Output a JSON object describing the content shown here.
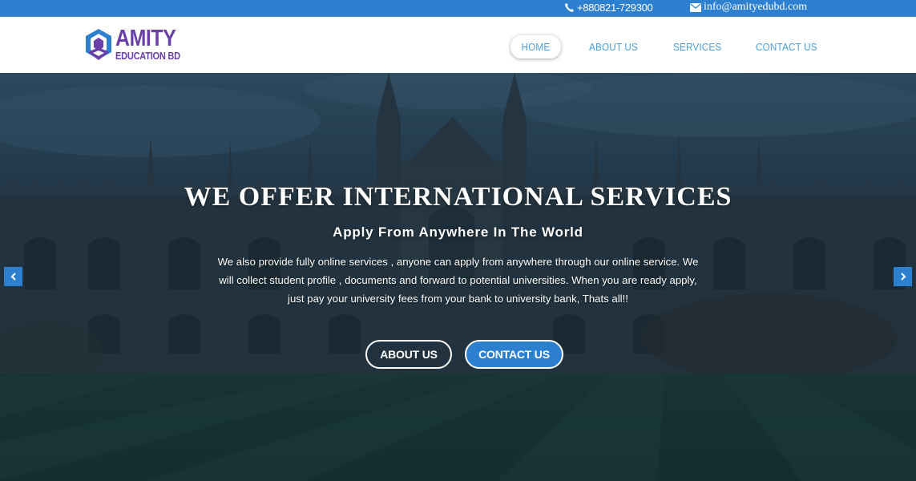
{
  "topbar": {
    "phone": "+880821-729300",
    "email": "info@amityedubd.com",
    "background": "#2d7fd0"
  },
  "brand": {
    "title": "AMITY",
    "subtitle": "EDUCATION BD",
    "color": "#6a3fa7"
  },
  "nav": {
    "items": [
      {
        "label": "HOME",
        "active": true
      },
      {
        "label": "ABOUT US",
        "active": false
      },
      {
        "label": "SERVICES",
        "active": false
      },
      {
        "label": "CONTACT US",
        "active": false
      }
    ],
    "color": "#4aa0e0"
  },
  "hero": {
    "title": "WE OFFER INTERNATIONAL SERVICES",
    "subtitle": "Apply From Anywhere In The World",
    "body_lines": [
      "We also provide fully online services , anyone can apply from anywhere through our online service. We",
      "will collect student profile , documents and forward to potential universities. When you are ready apply,",
      "just pay your university  fees from your bank to university bank, Thats all!!"
    ],
    "buttons": {
      "about": "ABOUT US",
      "contact": "CONTACT US"
    },
    "accent": "#2d7fd0"
  },
  "icons": {
    "phone": "phone-icon",
    "email": "envelope-icon",
    "prev": "chevron-left-icon",
    "next": "chevron-right-icon"
  }
}
